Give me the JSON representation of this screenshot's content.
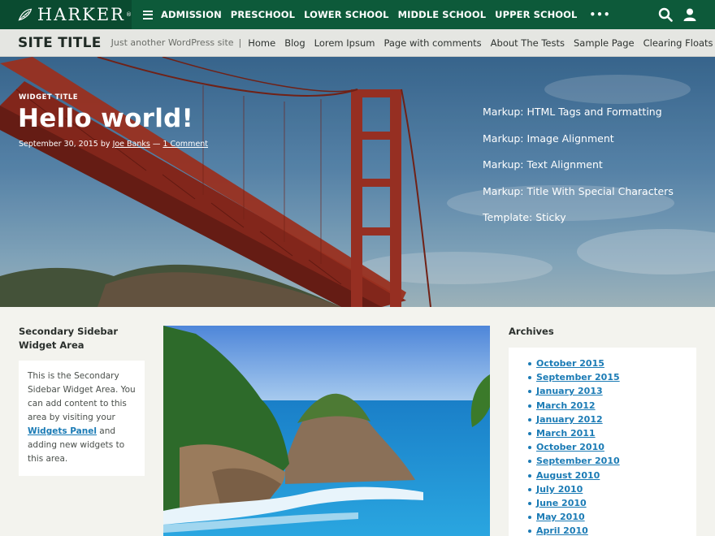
{
  "brand": {
    "name": "HARKER",
    "reg": "®",
    "color": "#0d5a3a"
  },
  "top_nav": {
    "items": [
      "ADMISSION",
      "PRESCHOOL",
      "LOWER SCHOOL",
      "MIDDLE SCHOOL",
      "UPPER SCHOOL"
    ],
    "more": "•••",
    "icons": [
      "search-icon",
      "user-icon"
    ]
  },
  "site_bar": {
    "title": "SITE TITLE",
    "tagline": "Just another WordPress site",
    "separator": "|",
    "items": [
      "Home",
      "Blog",
      "Lorem Ipsum",
      "Page with comments",
      "About The Tests",
      "Sample Page",
      "Clearing Floats"
    ],
    "more": "•••"
  },
  "hero": {
    "widget_title": "WIDGET TITLE",
    "title": "Hello world!",
    "date": "September 30, 2015",
    "by": "by",
    "author": "Joe Banks",
    "dash": "—",
    "comments": "1 Comment",
    "links": [
      "Markup: HTML Tags and Formatting",
      "Markup: Image Alignment",
      "Markup: Text Alignment",
      "Markup: Title With Special Characters",
      "Template: Sticky"
    ]
  },
  "secondary_sidebar": {
    "title": "Secondary Sidebar Widget Area",
    "text_before": "This is the Secondary Sidebar Widget Area. You can add content to this area by visiting your ",
    "link": "Widgets Panel",
    "text_after": " and adding new widgets to this area."
  },
  "archives": {
    "title": "Archives",
    "items": [
      "October 2015",
      "September 2015",
      "January 2013",
      "March 2012",
      "January 2012",
      "March 2011",
      "October 2010",
      "September 2010",
      "August 2010",
      "July 2010",
      "June 2010",
      "May 2010",
      "April 2010"
    ]
  }
}
